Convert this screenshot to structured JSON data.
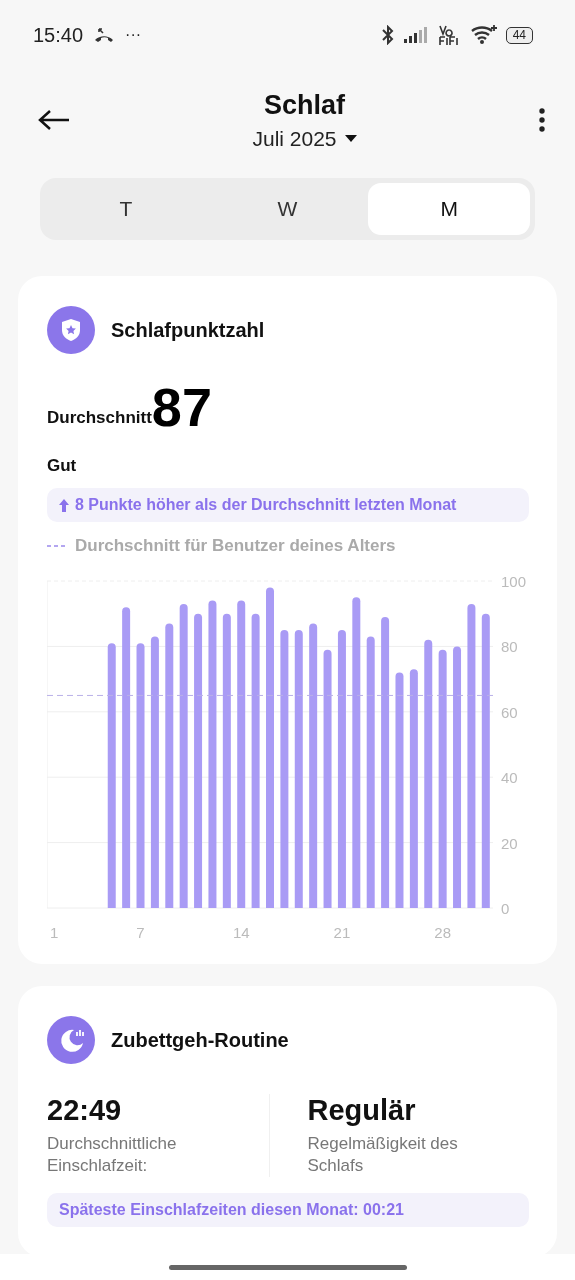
{
  "status_bar": {
    "time": "15:40",
    "more": "···",
    "battery": "44"
  },
  "header": {
    "title": "Schlaf",
    "period": "Juli 2025"
  },
  "tabs": [
    {
      "label": "T",
      "selected": false
    },
    {
      "label": "W",
      "selected": false
    },
    {
      "label": "M",
      "selected": true
    }
  ],
  "score_card": {
    "title": "Schlafpunktzahl",
    "average_label": "Durchschnitt",
    "average_value": "87",
    "rating": "Gut",
    "comparison": "8 Punkte höher als der Durchschnitt letzten Monat",
    "legend": "Durchschnitt für Benutzer deines Alters",
    "chart_data": {
      "type": "bar",
      "x": [
        5,
        6,
        7,
        8,
        9,
        10,
        11,
        12,
        13,
        14,
        15,
        16,
        17,
        18,
        19,
        20,
        21,
        22,
        23,
        24,
        25,
        26,
        27,
        28,
        29,
        30,
        31
      ],
      "series": [
        {
          "color": "#a99bf5",
          "values": [
            81,
            92,
            81,
            83,
            87,
            93,
            90,
            94,
            90,
            94,
            90,
            98,
            85,
            85,
            87,
            79,
            85,
            95,
            83,
            89,
            72,
            73,
            82,
            79,
            80,
            93,
            90
          ]
        }
      ],
      "xlim": [
        0.5,
        31.5
      ],
      "ylim": [
        0,
        100
      ],
      "yticks": [
        0,
        20,
        40,
        60,
        80,
        100
      ],
      "xticks": [
        1,
        7,
        14,
        21,
        28
      ],
      "grid": true,
      "ref_lines": [
        {
          "axis": "y",
          "value": 65
        }
      ]
    }
  },
  "routine_card": {
    "title": "Zubettgeh-Routine",
    "stats": [
      {
        "value": "22:49",
        "label": "Durchschnittliche Einschlafzeit:"
      },
      {
        "value": "Regulär",
        "label": "Regelmäßigkeit des Schlafs"
      }
    ],
    "note": "Späteste Einschlafzeiten diesen Monat: 00:21"
  }
}
